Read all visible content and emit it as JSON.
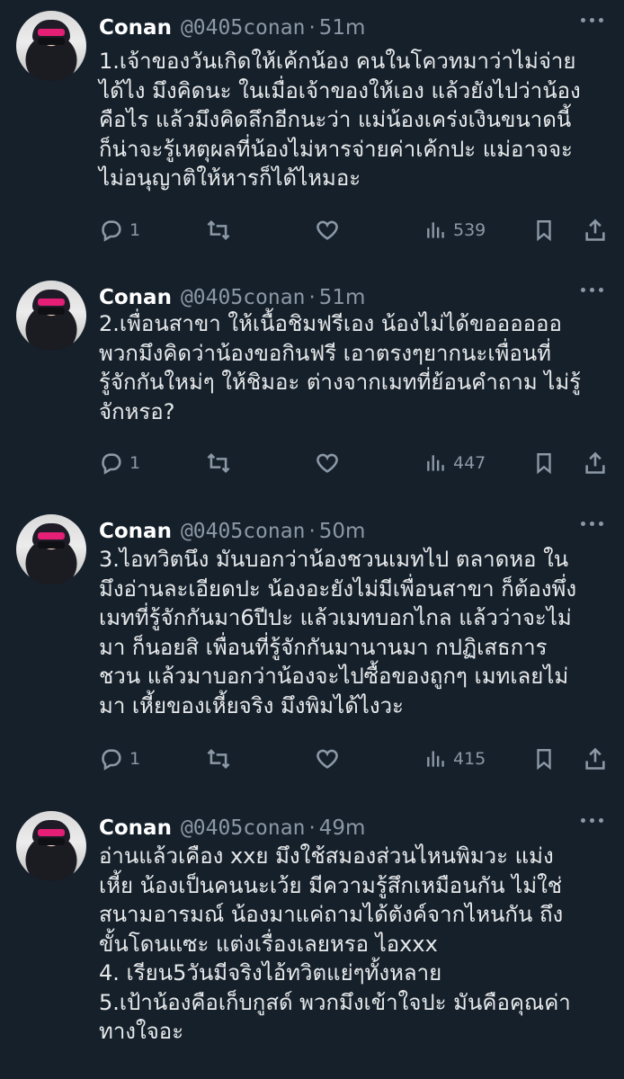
{
  "tweets": [
    {
      "name": "Conan",
      "handle": "@0405conan",
      "separator": "·",
      "time": "51m",
      "lines": [
        "1.เจ้าของวันเกิดให้เค้กน้อง คนในโควทมาว่าไม่จ่าย",
        "ได้ไง มึงคิดนะ ในเมื่อเจ้าของให้เอง แล้วยังไปว่าน้อง",
        "คือไร แล้วมึงคิดลึกอีกนะว่า แม่น้องเคร่งเงินขนาดนี้",
        "ก็น่าจะรู้เหตุผลที่น้องไม่หารจ่ายค่าเค้กปะ แม่อาจจะ",
        "ไม่อนุญาติให้หารก็ได้ไหมอะ"
      ],
      "replies": "1",
      "views": "539"
    },
    {
      "name": "Conan",
      "handle": "@0405conan",
      "separator": "·",
      "time": "51m",
      "lines": [
        "2.เพื่อนสาขา ให้เนื้อชิมฟรีเอง น้องไม่ได้ขออออออ",
        "พวกมึงคิดว่าน้องขอกินฟรี  เอาตรงๆยากนะเพื่อนที่",
        "รู้จักกันใหม่ๆ ให้ชิมอะ ต่างจากเมทที่ย้อนคำถาม ไม่รู้",
        "จักหรอ?"
      ],
      "replies": "1",
      "views": "447"
    },
    {
      "name": "Conan",
      "handle": "@0405conan",
      "separator": "·",
      "time": "50m",
      "lines": [
        "3.ไอทวิตนึง มันบอกว่าน้องชวนเมทไป ตลาดหอ ใน",
        "มึงอ่านละเอียดปะ น้องอะยังไม่มีเพื่อนสาขา ก็ต้องพึ่ง",
        "เมทที่รู้จักกันมา6ปีปะ แล้วเมทบอกไกล แล้วว่าจะไม่",
        "มา ก็นอยสิ เพื่อนที่รู้จักกันมานานมา กปฏิเสธการ",
        "ชวน แล้วมาบอกว่าน้องจะไปซื้อของถูกๆ เมทเลยไม่",
        "มา เหี้ยของเหี้ยจริง มึงพิมได้ไงวะ"
      ],
      "replies": "1",
      "views": "415"
    },
    {
      "name": "Conan",
      "handle": "@0405conan",
      "separator": "·",
      "time": "49m",
      "lines": [
        "อ่านแล้วเคือง xxย มึงใช้สมองส่วนไหนพิมวะ แม่ง",
        "เหี้ย น้องเป็นคนนะเว้ย มีความรู้สึกเหมือนกัน ไม่ใช่",
        "สนามอารมณ์ น้องมาแค่ถามได้ตังค์จากไหนกัน ถึง",
        "ขั้นโดนแซะ แต่งเรื่องเลยหรอ ไอxxx",
        "4. เรียน5วันมีจริงไอ้ทวิตแย่ๆทั้งหลาย",
        "5.เป้าน้องคือเก็บกูสด์ พวกมึงเข้าใจปะ มันคือคุณค่า",
        "ทางใจอะ"
      ],
      "replies": "",
      "views": ""
    }
  ],
  "icons": {
    "reply": "reply-bubble-icon",
    "retweet": "retweet-arrows-icon",
    "like": "heart-icon",
    "views": "bar-chart-icon",
    "bookmark": "bookmark-icon",
    "share": "share-upload-icon",
    "more": "more-dots-icon"
  },
  "colors": {
    "background": "#15202b",
    "text": "#e7e9ea",
    "muted": "#8b98a5"
  }
}
